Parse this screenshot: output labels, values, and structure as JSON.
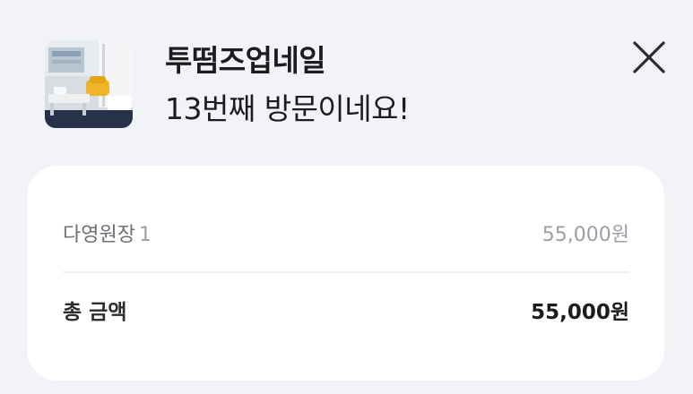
{
  "header": {
    "shop_name": "투떰즈업네일",
    "visit_message": "13번째 방문이네요!",
    "close_icon": "close-icon",
    "thumbnail": "shop-interior-photo"
  },
  "receipt": {
    "items": [
      {
        "name": "다영원장",
        "quantity": "1",
        "price": "55,000원"
      }
    ],
    "total_label": "총 금액",
    "total_value": "55,000원"
  },
  "colors": {
    "background": "#f1f3f6",
    "card": "#ffffff",
    "muted_text": "#9a9ea5",
    "strong_text": "#1c1c1e"
  }
}
